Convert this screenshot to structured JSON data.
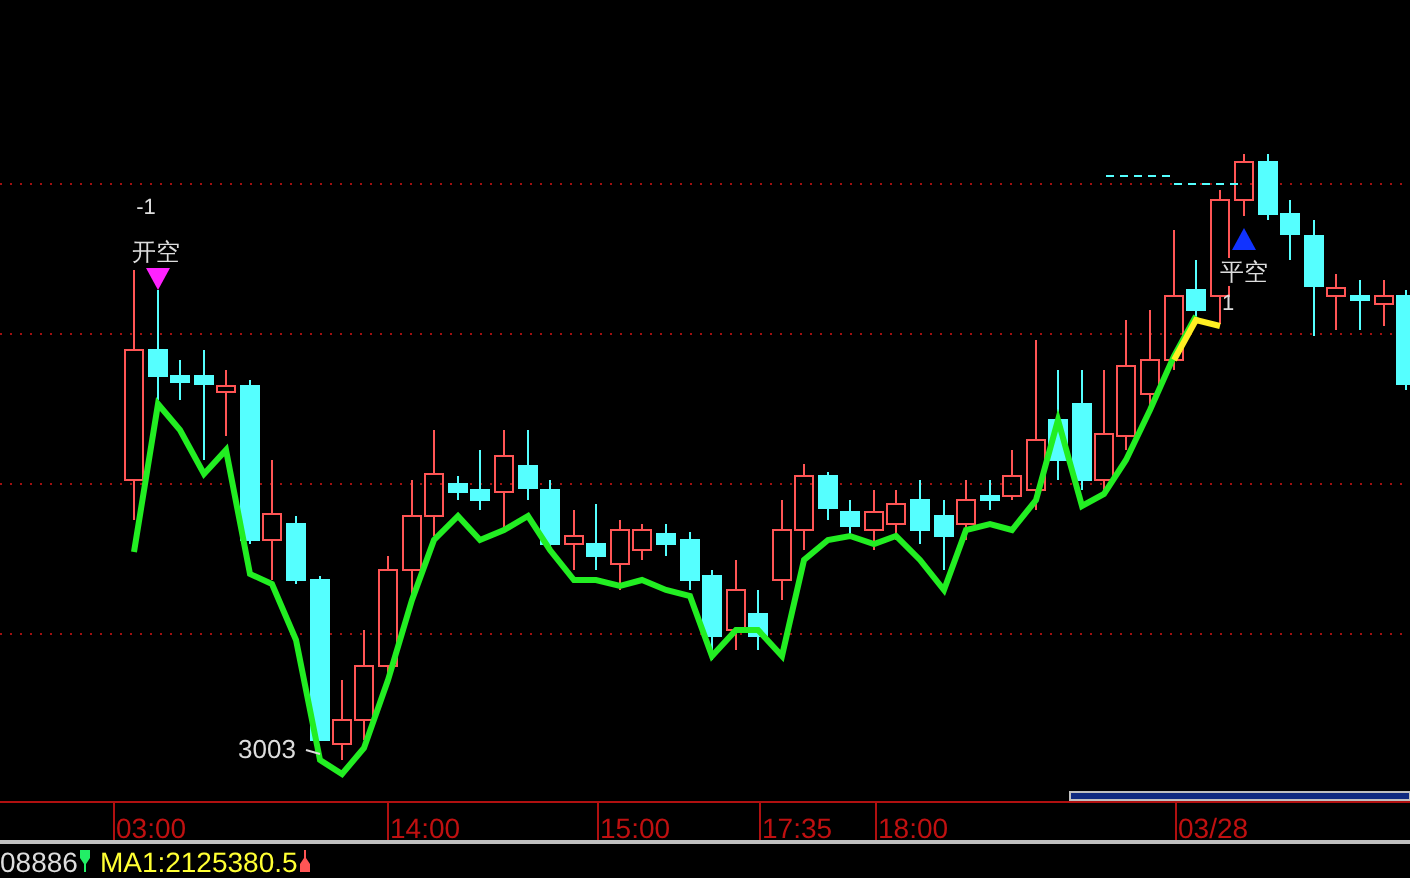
{
  "chart": {
    "signals": [
      {
        "kind": "open_short",
        "count": "-1",
        "label": "开空"
      },
      {
        "kind": "close_short",
        "count": "1",
        "label": "平空"
      }
    ],
    "low_label": "3003",
    "time_labels": [
      "03:00",
      "14:00",
      "15:00",
      "17:35",
      "18:00",
      "03/28"
    ]
  },
  "status_bar": {
    "value": "08886",
    "indicator": "MA1:2125380.5"
  }
}
